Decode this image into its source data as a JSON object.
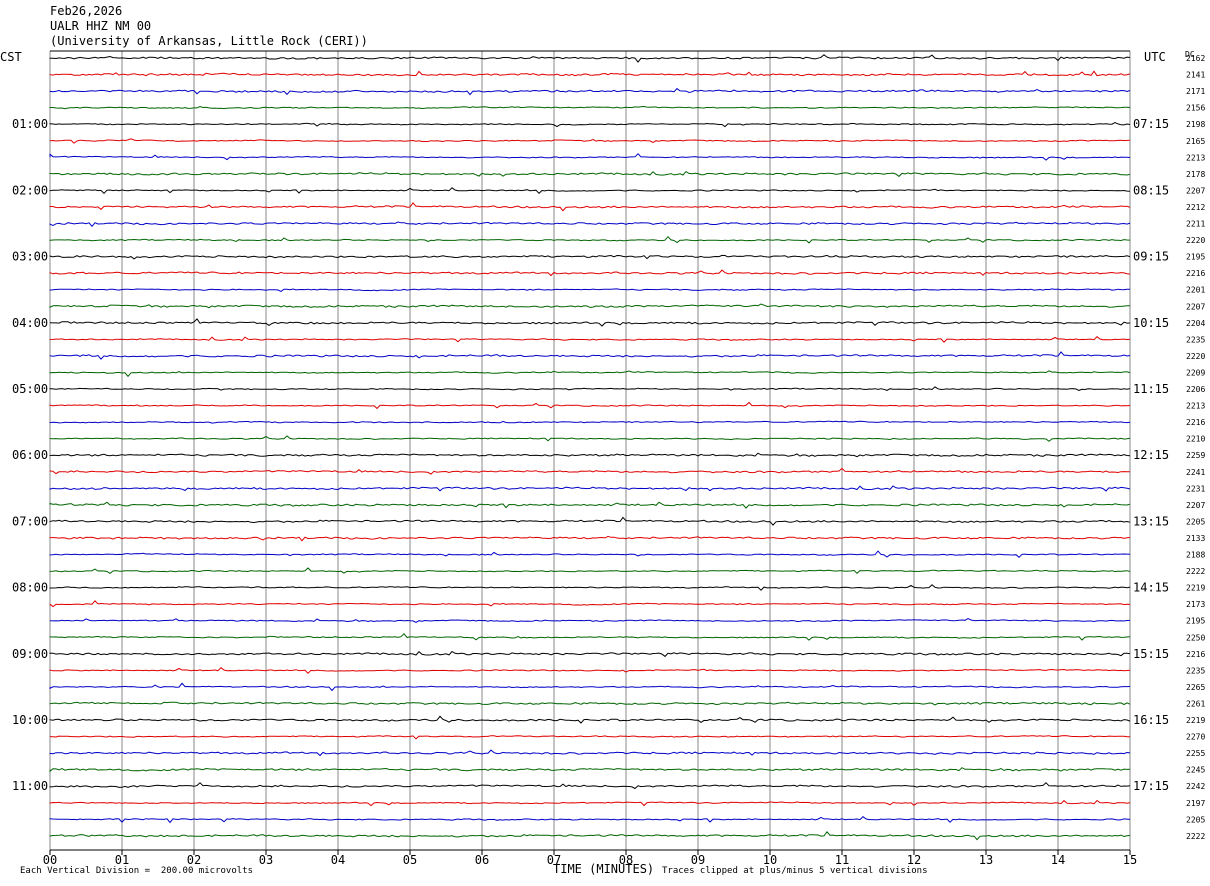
{
  "header": {
    "date": "Feb26,2026",
    "station": "UALR HHZ NM 00",
    "network": "(University of Arkansas, Little Rock (CERI))"
  },
  "axes": {
    "left_zone": "CST",
    "right_zone": "UTC",
    "dc_label": "DC",
    "x_title": "TIME (MINUTES)",
    "scale_note": "Each Vertical Division =  200.00 microvolts",
    "clip_note": "Traces clipped at plus/minus 5 vertical divisions"
  },
  "chart_data": {
    "type": "line",
    "title": "",
    "xlabel": "TIME (MINUTES)",
    "xlim": [
      0,
      15
    ],
    "x_ticks": [
      "00",
      "01",
      "02",
      "03",
      "04",
      "05",
      "06",
      "07",
      "08",
      "09",
      "10",
      "11",
      "12",
      "13",
      "14",
      "15"
    ],
    "row_count": 48,
    "left_time_labels": [
      "01:00",
      "02:00",
      "03:00",
      "04:00",
      "05:00",
      "06:00",
      "07:00",
      "08:00",
      "09:00",
      "10:00",
      "11:00"
    ],
    "right_time_labels": [
      "07:15",
      "08:15",
      "09:15",
      "10:15",
      "11:15",
      "12:15",
      "13:15",
      "14:15",
      "15:15",
      "16:15",
      "17:15"
    ],
    "dc_offsets": [
      "2162",
      "2141",
      "2171",
      "2156",
      "2198",
      "2165",
      "2213",
      "2178",
      "2207",
      "2212",
      "2211",
      "2220",
      "2195",
      "2216",
      "2201",
      "2207",
      "2204",
      "2235",
      "2220",
      "2209",
      "2206",
      "2213",
      "2216",
      "2210",
      "2259",
      "2241",
      "2231",
      "2207",
      "2205",
      "2133",
      "2188",
      "2222",
      "2219",
      "2173",
      "2195",
      "2250",
      "2216",
      "2235",
      "2265",
      "2261",
      "2219",
      "2270",
      "2255",
      "2245",
      "2242",
      "2197",
      "2205",
      "2222"
    ],
    "trace_colors": [
      "#000000",
      "#e00000",
      "#0000c8",
      "#006400"
    ],
    "grid": true
  }
}
